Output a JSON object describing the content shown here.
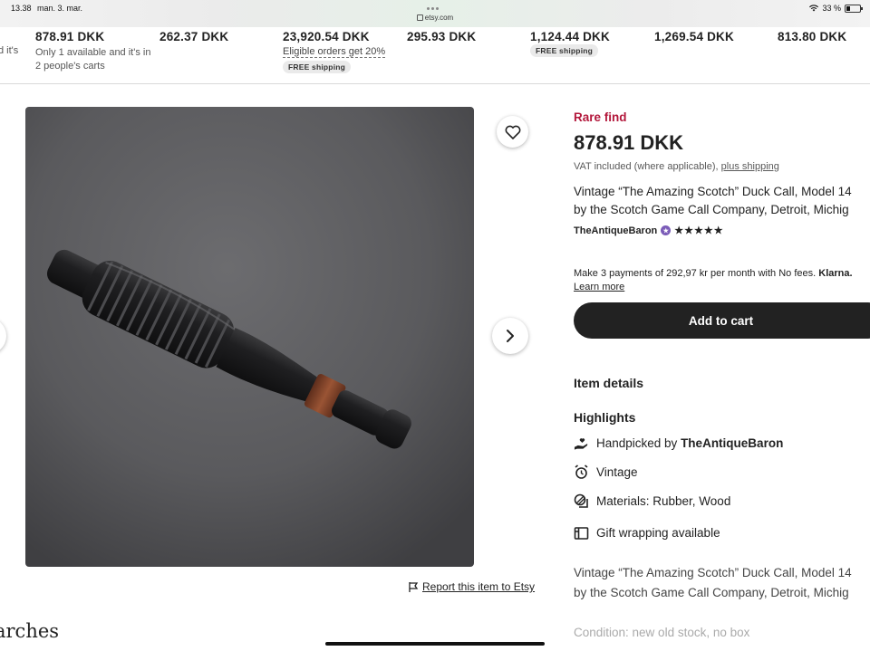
{
  "status_bar": {
    "time": "13.38",
    "date": "man. 3. mar.",
    "url": "etsy.com",
    "battery": "33 %"
  },
  "recommendations": [
    {
      "price": "878.91 DKK",
      "sub": "Only 1 available and it's in 2 people's carts",
      "prefix": "d it's"
    },
    {
      "price": "262.37 DKK"
    },
    {
      "price": "23,920.54 DKK",
      "link": "Eligible orders get 20%",
      "badge": "FREE shipping"
    },
    {
      "price": "295.93 DKK"
    },
    {
      "price": "1,124.44 DKK",
      "badge": "FREE shipping"
    },
    {
      "price": "1,269.54 DKK"
    },
    {
      "price": "813.80 DKK"
    }
  ],
  "listing": {
    "rare_label": "Rare find",
    "price": "878.91 DKK",
    "vat_text": "VAT included (where applicable), ",
    "vat_link": "plus shipping",
    "title_line1": "Vintage “The Amazing Scotch” Duck Call, Model 14",
    "title_line2": "by the Scotch Game Call Company, Detroit, Michig",
    "shop_name": "TheAntiqueBaron",
    "rating_stars": "★★★★★",
    "rating": 5,
    "klarna_text": "Make 3 payments of 292,97 kr per month with No fees. ",
    "klarna_brand": "Klarna.",
    "klarna_learn": "Learn more",
    "add_to_cart": "Add to cart",
    "item_details": "Item details",
    "highlights_heading": "Highlights",
    "highlights": [
      {
        "icon": "hand-heart-icon",
        "text": "Handpicked by ",
        "bold": "TheAntiqueBaron"
      },
      {
        "icon": "alarm-clock-icon",
        "text": "Vintage"
      },
      {
        "icon": "materials-icon",
        "text": "Materials: Rubber, Wood"
      },
      {
        "icon": "gift-icon",
        "text": "Gift wrapping available"
      }
    ],
    "desc_line1": "Vintage “The Amazing Scotch” Duck Call, Model 14",
    "desc_line2": "by the Scotch Game Call Company, Detroit, Michig",
    "condition": "Condition: new old stock, no box"
  },
  "report_link": "Report this item to Etsy",
  "searches_heading": "arches"
}
